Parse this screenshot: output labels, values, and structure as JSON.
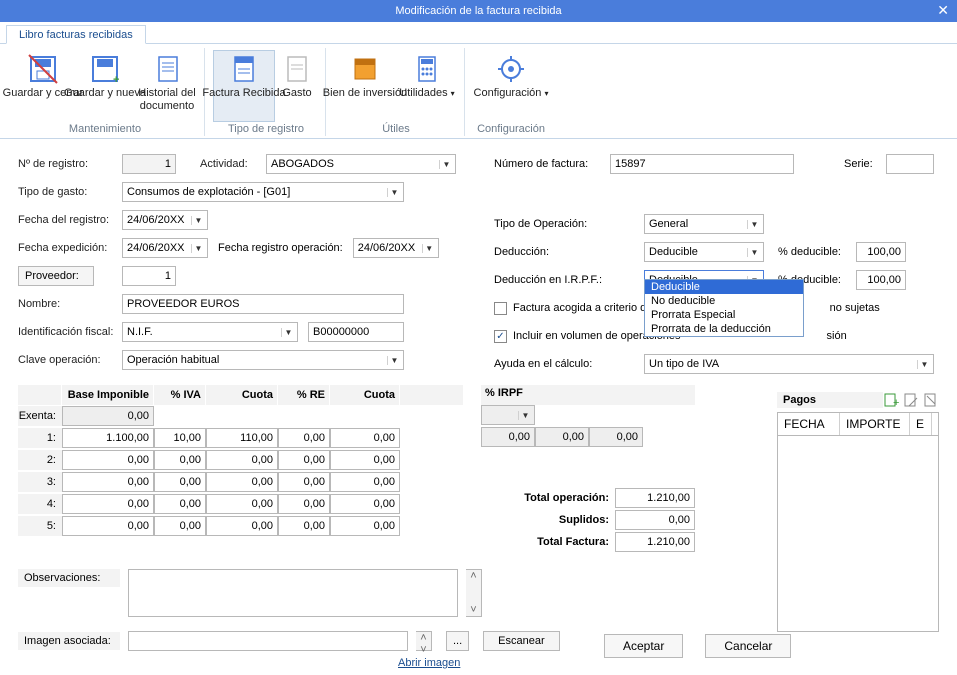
{
  "window": {
    "title": "Modificación de la factura recibida"
  },
  "tab": {
    "label": "Libro facturas recibidas"
  },
  "ribbon": {
    "groups": [
      {
        "title": "Mantenimiento",
        "items": [
          {
            "label": "Guardar y cerrar"
          },
          {
            "label": "Guardar y nueva"
          },
          {
            "label": "Historial del documento"
          }
        ]
      },
      {
        "title": "Tipo de registro",
        "items": [
          {
            "label": "Factura Recibida"
          },
          {
            "label": "Gasto"
          }
        ]
      },
      {
        "title": "Útiles",
        "items": [
          {
            "label": "Bien de inversión"
          },
          {
            "label": "Utilidades"
          }
        ]
      },
      {
        "title": "Configuración",
        "items": [
          {
            "label": "Configuración"
          }
        ]
      }
    ]
  },
  "form": {
    "n_registro_lbl": "Nº de registro:",
    "n_registro": "1",
    "actividad_lbl": "Actividad:",
    "actividad": "ABOGADOS",
    "tipo_gasto_lbl": "Tipo de gasto:",
    "tipo_gasto": "Consumos de explotación - [G01]",
    "fecha_registro_lbl": "Fecha del registro:",
    "fecha_registro": "24/06/20XX",
    "fecha_exped_lbl": "Fecha expedición:",
    "fecha_exped": "24/06/20XX",
    "fecha_reg_op_lbl": "Fecha registro operación:",
    "fecha_reg_op": "24/06/20XX",
    "proveedor_btn": "Proveedor:",
    "proveedor": "1",
    "nombre_lbl": "Nombre:",
    "nombre": "PROVEEDOR EUROS",
    "id_fiscal_lbl": "Identificación fiscal:",
    "id_fiscal_tipo": "N.I.F.",
    "id_fiscal_val": "B00000000",
    "clave_op_lbl": "Clave operación:",
    "clave_op": "Operación habitual",
    "num_factura_lbl": "Número de factura:",
    "num_factura": "15897",
    "serie_lbl": "Serie:",
    "serie": "",
    "tipo_op_lbl": "Tipo de Operación:",
    "tipo_op": "General",
    "deduccion_lbl": "Deducción:",
    "deduccion": "Deducible",
    "pct_ded_lbl": "% deducible:",
    "pct_ded": "100,00",
    "ded_irpf_lbl": "Deducción en I.R.P.F.:",
    "ded_irpf": "Deducible",
    "pct_ded2": "100,00",
    "caja_lbl": "Factura acogida a criterio de caja",
    "sujetas_lbl": "no sujetas",
    "volumen_lbl": "Incluir en  volumen de operaciones",
    "sion_lbl": "sión",
    "ayuda_lbl": "Ayuda en el cálculo:",
    "ayuda": "Un tipo de IVA",
    "dd_options": [
      "Deducible",
      "No deducible",
      "Prorrata Especial",
      "Prorrata de la deducción"
    ]
  },
  "iva": {
    "hdr_base": "Base Imponible",
    "hdr_piva": "% IVA",
    "hdr_cuota": "Cuota",
    "hdr_pre": "% RE",
    "hdr_cuota2": "Cuota",
    "hdr_pirpf": "% IRPF",
    "exenta_lbl": "Exenta:",
    "rows": [
      {
        "lbl": "Exenta:",
        "base": "0,00",
        "piva": "",
        "cuota": "",
        "pre": "",
        "cuota2": ""
      },
      {
        "lbl": "1:",
        "base": "1.100,00",
        "piva": "10,00",
        "cuota": "110,00",
        "pre": "0,00",
        "cuota2": "0,00"
      },
      {
        "lbl": "2:",
        "base": "0,00",
        "piva": "0,00",
        "cuota": "0,00",
        "pre": "0,00",
        "cuota2": "0,00"
      },
      {
        "lbl": "3:",
        "base": "0,00",
        "piva": "0,00",
        "cuota": "0,00",
        "pre": "0,00",
        "cuota2": "0,00"
      },
      {
        "lbl": "4:",
        "base": "0,00",
        "piva": "0,00",
        "cuota": "0,00",
        "pre": "0,00",
        "cuota2": "0,00"
      },
      {
        "lbl": "5:",
        "base": "0,00",
        "piva": "0,00",
        "cuota": "0,00",
        "pre": "0,00",
        "cuota2": "0,00"
      }
    ],
    "irpf_row": {
      "pirpf": "0,00",
      "v1": "0,00",
      "v2": "0,00"
    },
    "total_op_lbl": "Total operación:",
    "total_op": "1.210,00",
    "suplidos_lbl": "Suplidos:",
    "suplidos": "0,00",
    "total_fac_lbl": "Total Factura:",
    "total_fac": "1.210,00"
  },
  "pagos": {
    "title": "Pagos",
    "col_fecha": "FECHA",
    "col_importe": "IMPORTE",
    "col_e": "E"
  },
  "obs": {
    "lbl": "Observaciones:",
    "val": ""
  },
  "img": {
    "lbl": "Imagen asociada:",
    "val": "",
    "browse": "...",
    "scan": "Escanear",
    "open": "Abrir imagen"
  },
  "buttons": {
    "ok": "Aceptar",
    "cancel": "Cancelar"
  }
}
